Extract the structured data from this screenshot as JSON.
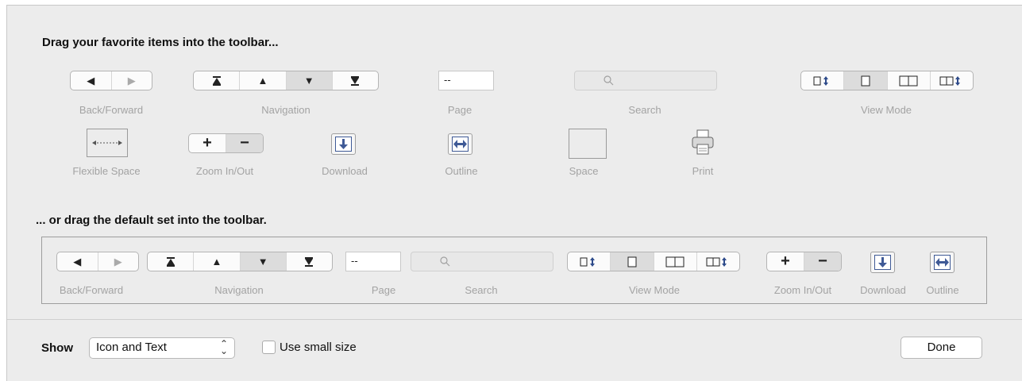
{
  "heading_top": "Drag your favorite items into the toolbar...",
  "heading_default": "... or drag the default set into the toolbar.",
  "items": {
    "back_forward": "Back/Forward",
    "navigation": "Navigation",
    "page": "Page",
    "page_value": "--",
    "search": "Search",
    "view_mode": "View Mode",
    "flexible_space": "Flexible Space",
    "zoom": "Zoom In/Out",
    "download": "Download",
    "outline": "Outline",
    "space": "Space",
    "print": "Print"
  },
  "glyphs": {
    "back": "◀",
    "forward": "▶",
    "first": "⏫",
    "up": "▲",
    "down": "▼",
    "last": "⏬",
    "plus": "+",
    "minus": "−"
  },
  "footer": {
    "show_label": "Show",
    "show_value": "Icon and Text",
    "small_size_label": "Use small size",
    "done_label": "Done"
  },
  "colors": {
    "background": "#ececec",
    "icon_accent": "#3f5a96"
  }
}
